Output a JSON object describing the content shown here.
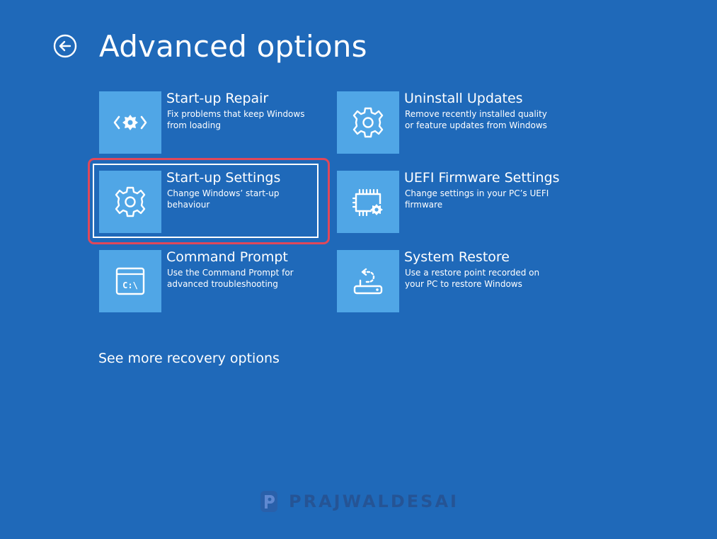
{
  "header": {
    "title": "Advanced options"
  },
  "options": [
    {
      "title": "Start-up Repair",
      "desc": "Fix problems that keep Windows from loading",
      "icon": "repair-icon"
    },
    {
      "title": "Uninstall Updates",
      "desc": "Remove recently installed quality or feature updates from Windows",
      "icon": "gear-icon"
    },
    {
      "title": "Start-up Settings",
      "desc": "Change Windows’ start-up behaviour",
      "icon": "gear-icon",
      "selected": true
    },
    {
      "title": "UEFI Firmware Settings",
      "desc": "Change settings in your PC’s UEFI firmware",
      "icon": "chip-gear-icon"
    },
    {
      "title": "Command Prompt",
      "desc": "Use the Command Prompt for advanced troubleshooting",
      "icon": "command-prompt-icon",
      "glyph": "C:\\"
    },
    {
      "title": "System Restore",
      "desc": "Use a restore point recorded on your PC to restore Windows",
      "icon": "restore-icon"
    }
  ],
  "footer": {
    "more_link": "See more recovery options"
  },
  "watermark": {
    "text": "PRAJWALDESAI"
  },
  "colors": {
    "background": "#1f69b9",
    "tile": "#50a6e6",
    "highlight": "#e0485a",
    "text": "#ffffff"
  }
}
